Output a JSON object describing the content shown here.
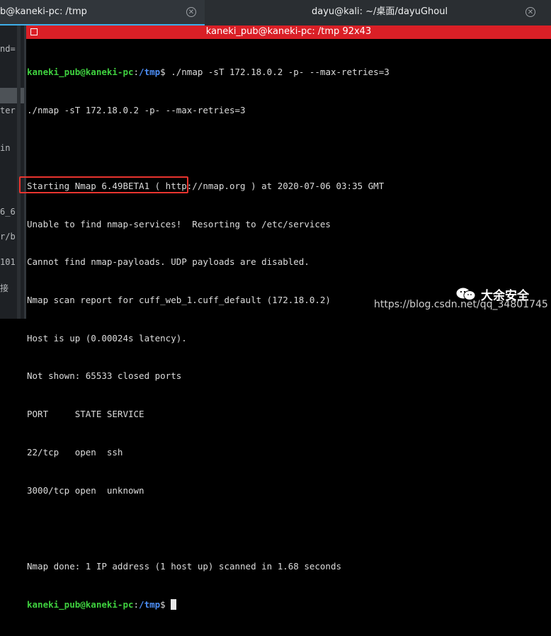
{
  "tabs": [
    {
      "label": "b@kaneki-pc: /tmp",
      "active": true
    },
    {
      "label": "dayu@kali: ~/桌面/dayuGhoul",
      "active": false
    }
  ],
  "left_pane_fragments": [
    "nd=",
    "ter",
    "in",
    "6_6",
    "r/b",
    "101",
    "接"
  ],
  "terminal": {
    "title": "kaneki_pub@kaneki-pc: /tmp 92x43",
    "prompt_user": "kaneki_pub@kaneki-pc",
    "prompt_sep": ":",
    "prompt_path": "/tmp",
    "prompt_symbol": "$",
    "command": " ./nmap -sT 172.18.0.2 -p- --max-retries=3",
    "echo": "./nmap -sT 172.18.0.2 -p- --max-retries=3",
    "output": [
      "",
      "Starting Nmap 6.49BETA1 ( http://nmap.org ) at 2020-07-06 03:35 GMT",
      "Unable to find nmap-services!  Resorting to /etc/services",
      "Cannot find nmap-payloads. UDP payloads are disabled.",
      "Nmap scan report for cuff_web_1.cuff_default (172.18.0.2)",
      "Host is up (0.00024s latency).",
      "Not shown: 65533 closed ports",
      "PORT     STATE SERVICE",
      "22/tcp   open  ssh",
      "3000/tcp open  unknown",
      "",
      "Nmap done: 1 IP address (1 host up) scanned in 1.68 seconds"
    ],
    "colors": {
      "titlebar": "#da1f26",
      "prompt_user": "#3fd13f",
      "prompt_path": "#4d8ff7",
      "highlight": "#e8342f"
    }
  },
  "watermark": {
    "brand": "大余安全",
    "url": "https://blog.csdn.net/qq_34801745"
  }
}
